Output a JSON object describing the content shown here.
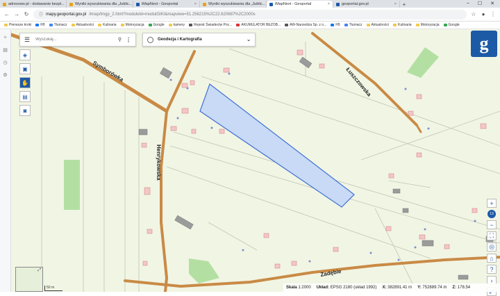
{
  "browser": {
    "tabs": [
      {
        "title": "adresowo.pl - dodawanie bezpł..."
      },
      {
        "title": "Wyniki wyszukiwania dla „Jublic..."
      },
      {
        "title": "iMapNext - Geoportal"
      },
      {
        "title": "Wyniki wyszukiwania dla „Jublic..."
      },
      {
        "title": "iMapNext - Geoportal",
        "active": true
      },
      {
        "title": "geoportal.gov.pl"
      }
    ],
    "new_tab": "+",
    "url_host": "mapy.geoportal.gov.pl",
    "url_rest": "/imap/Imgp_2.html?moduleId=modulGIKI&mapview=51.256215%2C22.620687%2C2000s",
    "bookmarks": [
      "Pierwsze kroki",
      "FB",
      "Tłumacz",
      "Aktualności",
      "Kulinaria",
      "Motoryzacja",
      "Google",
      "kamery",
      "Rejestr Świadectw Poc...",
      "AKUMULATOR BEZOB...",
      "AW-Narzedzia Sp. z o...",
      "FB",
      "Tłumacz",
      "Aktualności",
      "Kulinaria",
      "Motoryzacja",
      "Google"
    ]
  },
  "search": {
    "placeholder": "Wyszukaj..."
  },
  "layer_select": {
    "label": "Geodezja i Kartografia"
  },
  "logo": {
    "letter": "g"
  },
  "map": {
    "roads": [
      "Symborówka",
      "Łuszczowska",
      "Henrykowska",
      "Zadębie"
    ],
    "zoom_level": "13"
  },
  "scale_bar": {
    "label": "50 m"
  },
  "status": {
    "scale_label": "Skala",
    "scale_value": "1:2000",
    "crs_label": "Układ:",
    "crs_value": "EPSG 2180 (układ 1992)",
    "x_label": "X:",
    "x_value": "382891.41 m",
    "y_label": "Y:",
    "y_value": "752889.74 m",
    "z_label": "Z:",
    "z_value": "178.54"
  },
  "colors": {
    "accent": "#1c5aa6",
    "road": "#c98a45",
    "parcel_fill": "#c8daf5",
    "parcel_stroke": "#3f6fd6",
    "map_bg": "#f1f5e4",
    "green": "#9ed88c"
  }
}
